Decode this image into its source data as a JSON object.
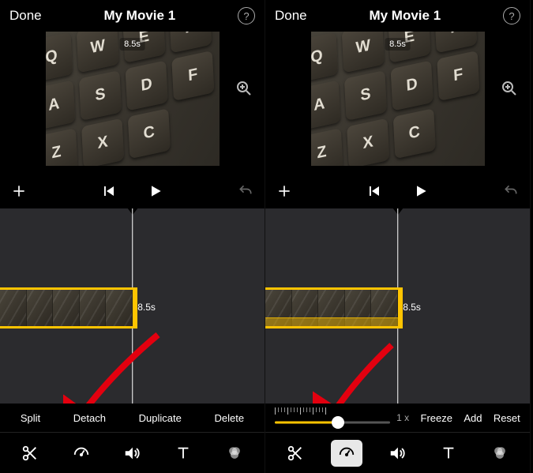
{
  "left": {
    "header": {
      "done": "Done",
      "title": "My Movie 1"
    },
    "preview": {
      "duration_badge": "8.5s"
    },
    "clip": {
      "duration": "8.5s"
    },
    "actions": {
      "split": "Split",
      "detach": "Detach",
      "duplicate": "Duplicate",
      "delete": "Delete"
    }
  },
  "right": {
    "header": {
      "done": "Done",
      "title": "My Movie 1"
    },
    "preview": {
      "duration_badge": "8.5s"
    },
    "clip": {
      "duration": "8.5s"
    },
    "speed": {
      "value_label": "1 x",
      "fill_percent": 55
    },
    "actions": {
      "freeze": "Freeze",
      "add": "Add",
      "reset": "Reset"
    }
  },
  "key_rows": [
    [
      "Q",
      "W",
      "E",
      "R"
    ],
    [
      "A",
      "S",
      "D",
      "F"
    ],
    [
      "Z",
      "X",
      "C"
    ]
  ]
}
